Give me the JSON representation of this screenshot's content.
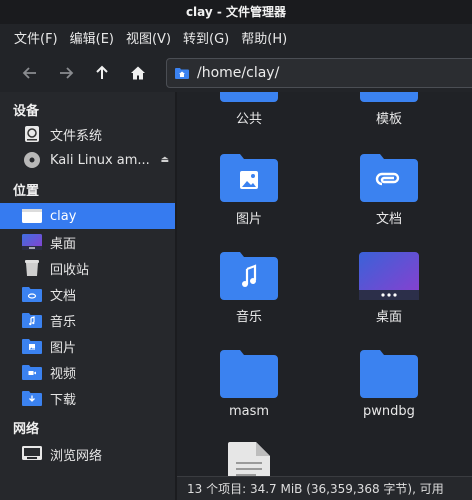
{
  "window": {
    "title": "clay - 文件管理器"
  },
  "menubar": [
    {
      "label": "文件(F)"
    },
    {
      "label": "编辑(E)"
    },
    {
      "label": "视图(V)"
    },
    {
      "label": "转到(G)"
    },
    {
      "label": "帮助(H)"
    }
  ],
  "toolbar": {
    "back_icon": "arrow-left-icon",
    "forward_icon": "arrow-right-icon",
    "up_icon": "arrow-up-icon",
    "home_icon": "home-icon",
    "location": "/home/clay/"
  },
  "sidebar": {
    "devices_header": "设备",
    "devices": [
      {
        "label": "文件系统",
        "icon": "drive-icon"
      },
      {
        "label": "Kali Linux am...",
        "icon": "disc-icon",
        "eject": "⏏"
      }
    ],
    "places_header": "位置",
    "places": [
      {
        "label": "clay",
        "icon": "home-folder-icon",
        "selected": true
      },
      {
        "label": "桌面",
        "icon": "desktop-icon"
      },
      {
        "label": "回收站",
        "icon": "trash-icon"
      },
      {
        "label": "文档",
        "icon": "documents-folder-icon"
      },
      {
        "label": "音乐",
        "icon": "music-folder-icon"
      },
      {
        "label": "图片",
        "icon": "pictures-folder-icon"
      },
      {
        "label": "视频",
        "icon": "videos-folder-icon"
      },
      {
        "label": "下载",
        "icon": "downloads-folder-icon"
      }
    ],
    "network_header": "网络",
    "network": [
      {
        "label": "浏览网络",
        "icon": "network-icon"
      }
    ]
  },
  "files": [
    {
      "name": "公共",
      "icon": "public-folder-icon"
    },
    {
      "name": "模板",
      "icon": "templates-folder-icon"
    },
    {
      "name": "图片",
      "icon": "pictures-folder-icon"
    },
    {
      "name": "文档",
      "icon": "documents-folder-icon"
    },
    {
      "name": "音乐",
      "icon": "music-folder-icon"
    },
    {
      "name": "桌面",
      "icon": "desktop-icon"
    },
    {
      "name": "masm",
      "icon": "folder-icon"
    },
    {
      "name": "pwndbg",
      "icon": "folder-icon"
    },
    {
      "name": "",
      "icon": "text-file-icon"
    }
  ],
  "status": {
    "text": "13 个项目: 34.7 MiB (36,359,368 字节), 可用"
  },
  "colors": {
    "accent": "#367bf0",
    "folder": "#3b82f0",
    "background": "#202226"
  }
}
